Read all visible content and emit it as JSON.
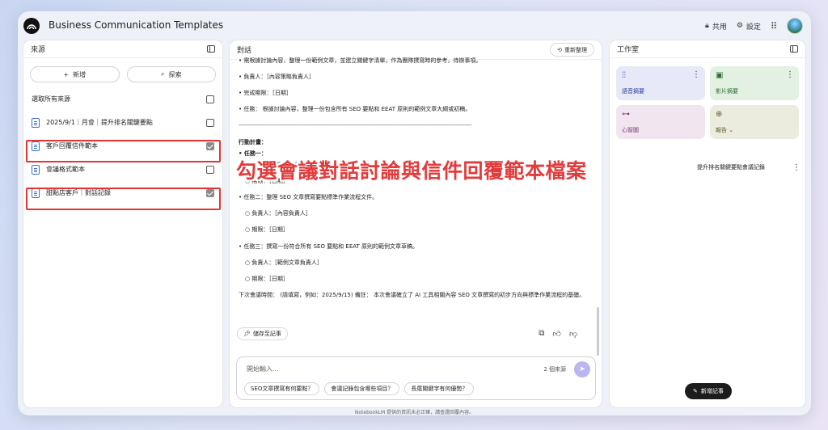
{
  "app": {
    "title": "Business Communication Templates",
    "share_label": "共用",
    "settings_label": "設定"
  },
  "sources": {
    "header": "來源",
    "add_label": "新增",
    "explore_label": "探索",
    "select_all_label": "選取所有來源",
    "items": [
      {
        "label": "2025/9/1｜月會｜提升排名關鍵要點",
        "checked": false
      },
      {
        "label": "客戶回覆信件範本",
        "checked": true
      },
      {
        "label": "會議格式範本",
        "checked": false
      },
      {
        "label": "甜點店客戶｜對話記錄",
        "checked": true
      }
    ]
  },
  "chat": {
    "header": "對話",
    "refresh_label": "重新整理",
    "lines": {
      "l0": "• 需根據討論內容，整理一份範例文章，並建立關鍵字清單，作為團隊撰寫時的參考，待辦事項。",
      "l1": "• 負責人：［內容策略負責人］",
      "l2": "• 完成期限：［日期］",
      "l3": "• 任務： 根據討論內容，整理一份包含所有 SEO 要點和 EEAT 原則的範例文章大綱或初稿。",
      "divider": "----------------------------------------------------------------------------------------------------------------------------------------------",
      "l4": "行動計畫：",
      "l5": "• 任務一：",
      "l6": "○ 負責人：［關鍵字負責人］",
      "l7": "○ 期限：［日期］",
      "l8": "• 任務二：整理 SEO 文章撰寫要點標準作業流程文件。",
      "l9": "○ 負責人：［內容負責人］",
      "l10": "○ 期限：［日期］",
      "l11": "• 任務三：撰寫一份符合所有 SEO 要點和 EEAT 原則的範例文章草稿。",
      "l12": "○ 負責人：［範例文章負責人］",
      "l13": "○ 期限：［日期］",
      "l14": "下次會議時間： (請填寫，例如：2025/9/15) 備註： 本次會議確立了 AI 工具相關內容 SEO 文章撰寫的初步方向與標準作業流程的基礎。"
    },
    "save_label": "儲存至記事",
    "input_placeholder": "開始輸入...",
    "source_count": "2 個來源",
    "suggestions": [
      "SEO文章撰寫有何要點？",
      "會議記錄包含哪些項目？",
      "長尾關鍵字有何優勢？"
    ]
  },
  "studio": {
    "header": "工作室",
    "tiles": [
      {
        "label": "語音摘要",
        "icon": "waveform-icon"
      },
      {
        "label": "影片摘要",
        "icon": "video-icon"
      },
      {
        "label": "心智圖",
        "icon": "mindmap-icon"
      },
      {
        "label": "報告",
        "icon": "report-icon"
      }
    ],
    "note_title": "提升排名關鍵要點會議記錄",
    "new_note_label": "新增記事"
  },
  "overlay_caption": "勾選會議對話討論與信件回覆範本檔案",
  "footer": "NotebookLM 提供的資訊未必正確，請查證回覆內容。",
  "colors": {
    "highlight": "#e23636",
    "accent": "#3b6ed4"
  }
}
